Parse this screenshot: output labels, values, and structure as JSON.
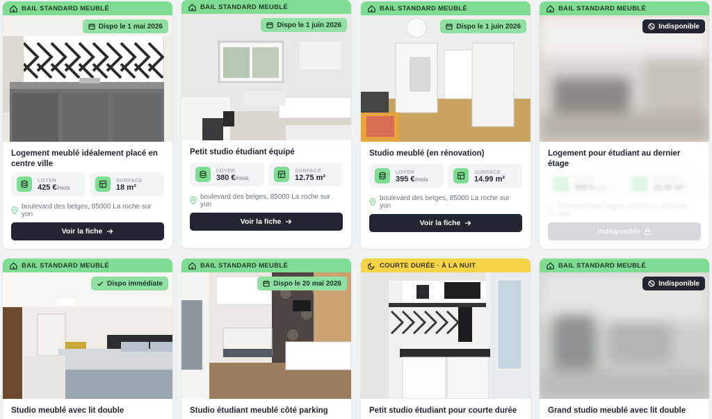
{
  "colors": {
    "accent_green": "#7edc93",
    "accent_yellow": "#f5d547",
    "button_dark": "#222632",
    "disabled": "#d6d8dc"
  },
  "listings": [
    {
      "tag": "BAIL STANDARD MEUBLÉ",
      "badge": "Dispo le 1 mai 2026",
      "title": "Logement meublé idéalement placé en centre ville",
      "rent_label": "LOYER",
      "rent_value": "425 €",
      "rent_unit": "/mois",
      "surface_label": "SURFACE",
      "surface_value": "18 m²",
      "address": "boulevard des belges, 85000 La roche sur yon",
      "button": "Voir la fiche"
    },
    {
      "tag": "BAIL STANDARD MEUBLÉ",
      "badge": "Dispo le 1 juin 2026",
      "title": "Petit studio étudiant équipé",
      "rent_label": "LOYER",
      "rent_value": "380 €",
      "rent_unit": "/mois",
      "surface_label": "SURFACE",
      "surface_value": "12.75 m²",
      "address": "boulevard des belges, 85000 La roche sur yon",
      "button": "Voir la fiche"
    },
    {
      "tag": "BAIL STANDARD MEUBLÉ",
      "badge": "Dispo le 1 juin 2026",
      "title": "Studio meublé (en rénovation)",
      "rent_label": "LOYER",
      "rent_value": "395 €",
      "rent_unit": "/mois",
      "surface_label": "SURFACE",
      "surface_value": "14.99 m²",
      "address": "boulevard des belges, 85000 La roche sur yon",
      "button": "Voir la fiche"
    },
    {
      "tag": "BAIL STANDARD MEUBLÉ",
      "badge": "Indisponible",
      "title": "Logement pour étudiant au dernier étage",
      "rent_label": "LOYER",
      "rent_value": "380 €",
      "rent_unit": "/mois",
      "surface_label": "SURFACE",
      "surface_value": "16.35 m²",
      "address": "boulevard des belges, 85000 La roche sur yon",
      "button": "Indisponible"
    },
    {
      "tag": "BAIL STANDARD MEUBLÉ",
      "badge": "Dispo immédiate",
      "title": "Studio meublé avec lit double"
    },
    {
      "tag": "BAIL STANDARD MEUBLÉ",
      "badge": "Dispo le 20 mai 2026",
      "title": "Studio étudiant meublé côté parking"
    },
    {
      "tag": "COURTE DURÉE · À LA NUIT",
      "badge": "",
      "title": "Petit studio étudiant pour courte durée"
    },
    {
      "tag": "BAIL STANDARD MEUBLÉ",
      "badge": "Indisponible",
      "title": "Grand studio meublé avec lit double"
    }
  ]
}
